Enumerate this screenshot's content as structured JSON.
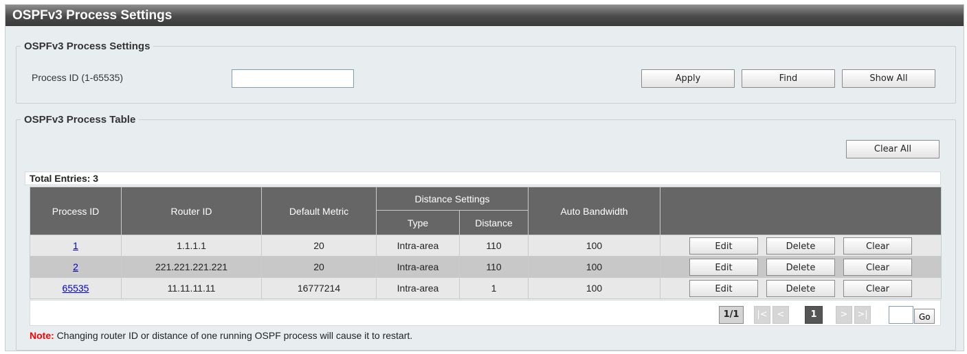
{
  "window": {
    "title": "OSPFv3 Process Settings"
  },
  "settings": {
    "legend": "OSPFv3 Process Settings",
    "process_id_label": "Process ID (1-65535)",
    "process_id_value": "",
    "apply_label": "Apply",
    "find_label": "Find",
    "show_all_label": "Show All"
  },
  "table_section": {
    "legend": "OSPFv3 Process Table",
    "clear_all_label": "Clear All",
    "total_entries": "Total Entries: 3",
    "headers": {
      "process_id": "Process ID",
      "router_id": "Router ID",
      "default_metric": "Default Metric",
      "distance_settings": "Distance Settings",
      "type": "Type",
      "distance": "Distance",
      "auto_bandwidth": "Auto Bandwidth"
    },
    "rows": [
      {
        "process_id": "1",
        "router_id": "1.1.1.1",
        "default_metric": "20",
        "type": "Intra-area",
        "distance": "110",
        "auto_bandwidth": "100",
        "edit": "Edit",
        "delete": "Delete",
        "clear": "Clear"
      },
      {
        "process_id": "2",
        "router_id": "221.221.221.221",
        "default_metric": "20",
        "type": "Intra-area",
        "distance": "110",
        "auto_bandwidth": "100",
        "edit": "Edit",
        "delete": "Delete",
        "clear": "Clear"
      },
      {
        "process_id": "65535",
        "router_id": "11.11.11.11",
        "default_metric": "16777214",
        "type": "Intra-area",
        "distance": "1",
        "auto_bandwidth": "100",
        "edit": "Edit",
        "delete": "Delete",
        "clear": "Clear"
      }
    ]
  },
  "pager": {
    "page_info": "1/1",
    "first": "|<",
    "prev": "<",
    "current": "1",
    "next": ">",
    "last": ">|",
    "go_label": "Go",
    "go_value": ""
  },
  "note": {
    "keyword": "Note:",
    "text": " Changing router ID or distance of one running OSPF process will cause it to restart."
  },
  "colors": {
    "header_bg": "#666666",
    "row_odd": "#e8e8e8",
    "row_even": "#c8c8c8",
    "link": "#0000cc",
    "note_keyword": "#ff0000"
  }
}
